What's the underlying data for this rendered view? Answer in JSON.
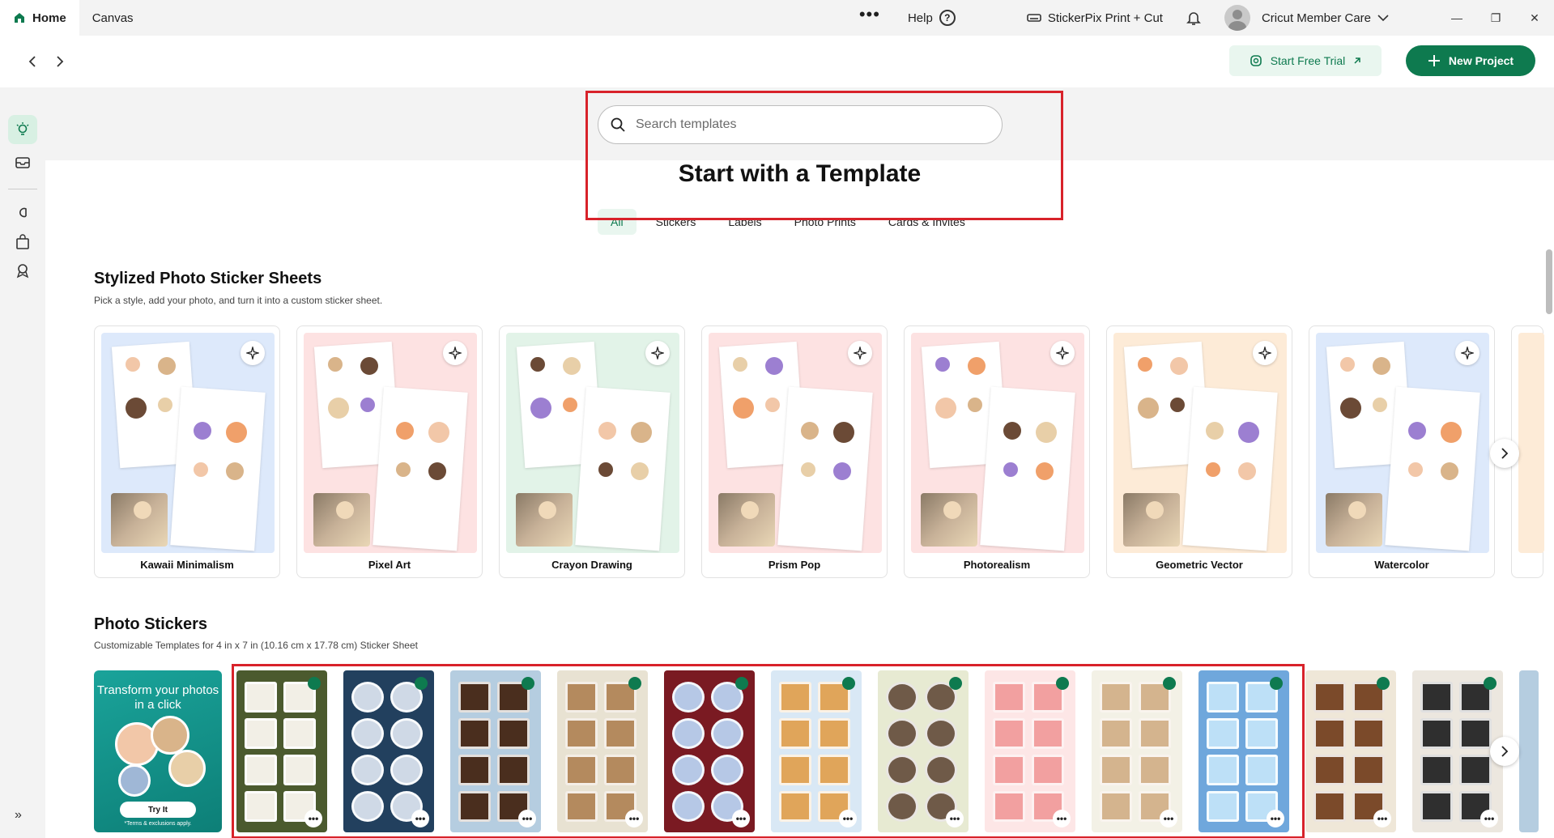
{
  "tabs": [
    {
      "label": "Home"
    },
    {
      "label": "Canvas"
    }
  ],
  "topbar": {
    "more": "•••",
    "help": "Help",
    "help_icon": "?",
    "machine": "StickerPix Print + Cut",
    "account": "Cricut Member Care"
  },
  "toolbar": {
    "trial_label": "Start Free Trial",
    "new_label": "New Project"
  },
  "search": {
    "placeholder": "Search templates"
  },
  "hero": {
    "title": "Start with a Template"
  },
  "categories": [
    {
      "label": "All",
      "active": true
    },
    {
      "label": "Stickers"
    },
    {
      "label": "Labels"
    },
    {
      "label": "Photo Prints"
    },
    {
      "label": "Cards & Invites"
    }
  ],
  "stylized": {
    "title": "Stylized Photo Sticker Sheets",
    "subtitle": "Pick a style, add your photo, and turn it into a custom sticker sheet.",
    "cards": [
      {
        "label": "Kawaii Minimalism",
        "bg": "#dde9fb"
      },
      {
        "label": "Pixel Art",
        "bg": "#fde2e2"
      },
      {
        "label": "Crayon Drawing",
        "bg": "#e2f3e8"
      },
      {
        "label": "Prism Pop",
        "bg": "#fde2e2"
      },
      {
        "label": "Photorealism",
        "bg": "#fde2e2"
      },
      {
        "label": "Geometric Vector",
        "bg": "#fdebd7"
      },
      {
        "label": "Watercolor",
        "bg": "#dde9fb"
      }
    ]
  },
  "photo_stickers": {
    "title": "Photo Stickers",
    "subtitle": "Customizable Templates for 4 in x 7 in (10.16 cm x 17.78 cm) Sticker Sheet",
    "promo_title": "Transform your photos in a click",
    "promo_button": "Try It",
    "promo_terms": "*Terms & exclusions apply.",
    "more_label": "•••",
    "thumbs": [
      {
        "bg": "#4b5a2e",
        "cell": "#f2efe6"
      },
      {
        "bg": "#22405e",
        "cell": "#cfd9e6"
      },
      {
        "bg": "#b5cde0",
        "cell": "#4a2e1e"
      },
      {
        "bg": "#e8e2d2",
        "cell": "#b48a5e"
      },
      {
        "bg": "#7a1a22",
        "cell": "#b6c8e6"
      },
      {
        "bg": "#d9e8f5",
        "cell": "#e0a55a"
      },
      {
        "bg": "#e7ead2",
        "cell": "#6f5a48"
      },
      {
        "bg": "#fde6e6",
        "cell": "#f2a0a0"
      },
      {
        "bg": "#f3f1e6",
        "cell": "#d4b48e"
      },
      {
        "bg": "#6fa7dc",
        "cell": "#bde0f7"
      },
      {
        "bg": "#efe7d8",
        "cell": "#7b4a2a"
      },
      {
        "bg": "#ece7df",
        "cell": "#2f2f2f"
      }
    ]
  }
}
